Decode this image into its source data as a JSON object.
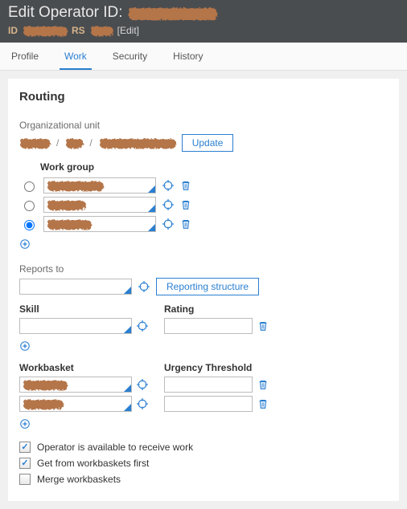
{
  "header": {
    "title_prefix": "Edit Operator ID:",
    "id_label": "ID",
    "rs_label": "RS",
    "edit_label": "[Edit]"
  },
  "tabs": [
    {
      "label": "Profile",
      "active": false
    },
    {
      "label": "Work",
      "active": true
    },
    {
      "label": "Security",
      "active": false
    },
    {
      "label": "History",
      "active": false
    }
  ],
  "routing": {
    "title": "Routing",
    "org_unit_label": "Organizational unit",
    "update_label": "Update",
    "work_group_label": "Work group",
    "work_groups": [
      {
        "selected": false
      },
      {
        "selected": false
      },
      {
        "selected": true
      }
    ],
    "reports_to_label": "Reports to",
    "reporting_structure_label": "Reporting structure",
    "skill_label": "Skill",
    "rating_label": "Rating",
    "workbasket_label": "Workbasket",
    "urgency_label": "Urgency Threshold",
    "checkboxes": {
      "available_label": "Operator is available to receive work",
      "available_checked": true,
      "workbaskets_first_label": "Get from workbaskets first",
      "workbaskets_first_checked": true,
      "merge_label": "Merge workbaskets",
      "merge_checked": false
    }
  },
  "icons": {
    "crosshair": "crosshair-icon",
    "trash": "trash-icon",
    "plus": "plus-circle-icon"
  }
}
